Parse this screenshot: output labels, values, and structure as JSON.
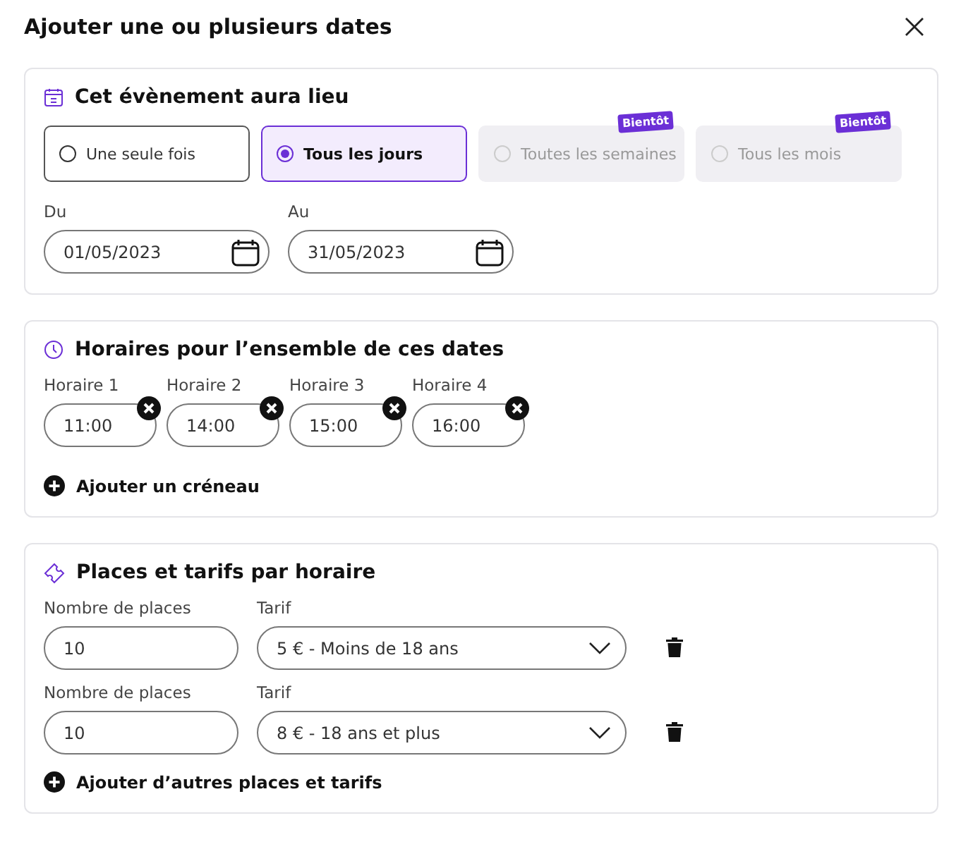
{
  "dialog": {
    "title": "Ajouter une ou plusieurs dates"
  },
  "occurrence": {
    "heading": "Cet évènement aura lieu",
    "options": [
      {
        "label": "Une seule fois",
        "selected": false,
        "disabled": false
      },
      {
        "label": "Tous les jours",
        "selected": true,
        "disabled": false
      },
      {
        "label": "Toutes les semaines",
        "selected": false,
        "disabled": true,
        "badge": "Bientôt"
      },
      {
        "label": "Tous les mois",
        "selected": false,
        "disabled": true,
        "badge": "Bientôt"
      }
    ],
    "dates": [
      {
        "label": "Du",
        "value": "01/05/2023"
      },
      {
        "label": "Au",
        "value": "31/05/2023"
      }
    ]
  },
  "schedules": {
    "heading": "Horaires pour l’ensemble de ces dates",
    "slots": [
      {
        "label": "Horaire 1",
        "value": "11:00"
      },
      {
        "label": "Horaire 2",
        "value": "14:00"
      },
      {
        "label": "Horaire 3",
        "value": "15:00"
      },
      {
        "label": "Horaire 4",
        "value": "16:00"
      }
    ],
    "add_label": "Ajouter un créneau"
  },
  "pricing": {
    "heading": "Places et tarifs par horaire",
    "rows": [
      {
        "places_label": "Nombre de places",
        "places": "10",
        "tarif_label": "Tarif",
        "tarif": "5 € - Moins de 18 ans"
      },
      {
        "places_label": "Nombre de places",
        "places": "10",
        "tarif_label": "Tarif",
        "tarif": "8 € - 18 ans et plus"
      }
    ],
    "add_label": "Ajouter d’autres places et tarifs"
  }
}
